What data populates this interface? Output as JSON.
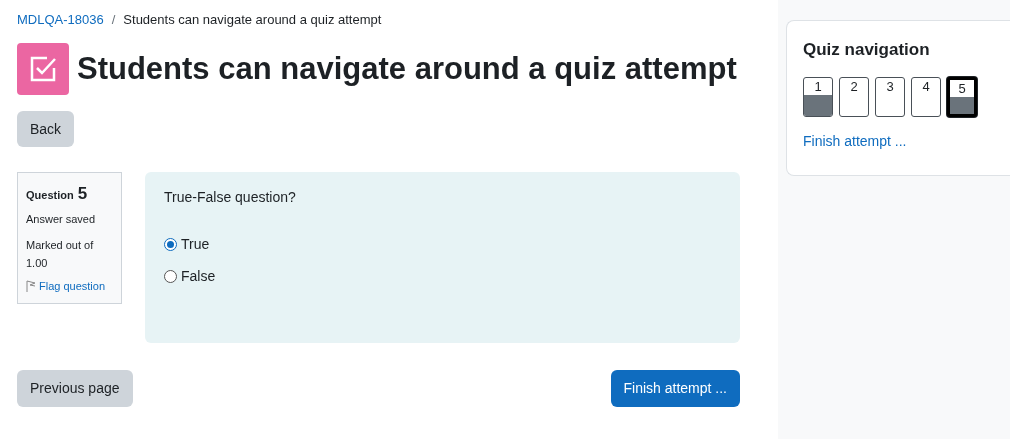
{
  "breadcrumb": [
    {
      "label": "MDLQA-18036",
      "link": true
    },
    {
      "label": "Students can navigate around a quiz attempt",
      "link": false
    }
  ],
  "breadcrumb_separator": "/",
  "title": "Students can navigate around a quiz attempt",
  "back_button": "Back",
  "question_info": {
    "label": "Question",
    "number": "5",
    "status": "Answer saved",
    "marked_out_of": "Marked out of",
    "mark": "1.00",
    "flag": "Flag question"
  },
  "question": {
    "text": "True-False question?",
    "options": [
      {
        "label": "True",
        "selected": true
      },
      {
        "label": "False",
        "selected": false
      }
    ]
  },
  "previous_button": "Previous page",
  "finish_button": "Finish attempt ...",
  "quiz_navigation": {
    "title": "Quiz navigation",
    "questions": [
      {
        "label": "1",
        "answered": true,
        "selected": false
      },
      {
        "label": "2",
        "answered": false,
        "selected": false
      },
      {
        "label": "3",
        "answered": false,
        "selected": false
      },
      {
        "label": "4",
        "answered": false,
        "selected": false
      },
      {
        "label": "5",
        "answered": true,
        "selected": true
      }
    ],
    "finish_link": "Finish attempt ..."
  }
}
